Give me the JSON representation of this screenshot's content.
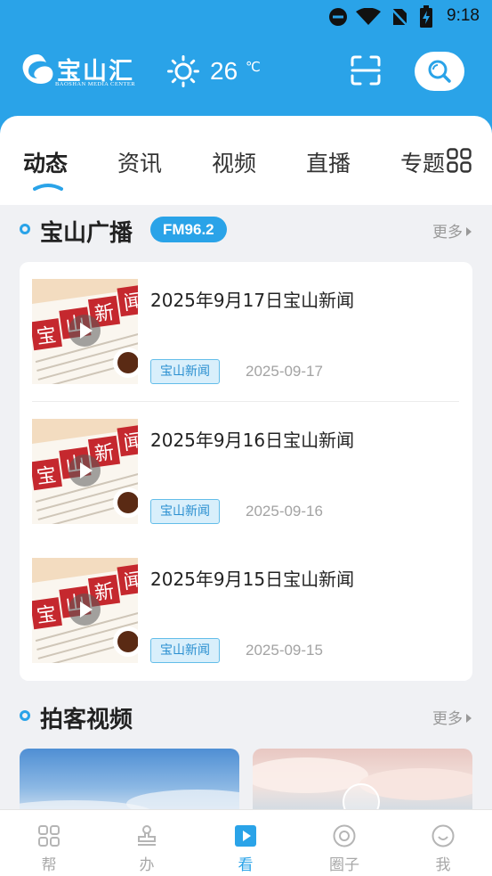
{
  "status_bar": {
    "time": "9:18"
  },
  "header": {
    "logo_text": "宝山汇",
    "logo_subtitle": "BAOSHAN MEDIA CENTER",
    "weather_icon": "sun-icon",
    "temperature": "26",
    "temperature_unit": "℃",
    "scan_icon": "scan-icon",
    "search_icon": "search-icon"
  },
  "tabs": [
    {
      "label": "动态",
      "active": true
    },
    {
      "label": "资讯",
      "active": false
    },
    {
      "label": "视频",
      "active": false
    },
    {
      "label": "直播",
      "active": false
    },
    {
      "label": "专题",
      "active": false
    }
  ],
  "radio_section": {
    "title": "宝山广播",
    "badge": "FM96.2",
    "more": "更多",
    "items": [
      {
        "title": "2025年9月17日宝山新闻",
        "tag": "宝山新闻",
        "date": "2025-09-17"
      },
      {
        "title": "2025年9月16日宝山新闻",
        "tag": "宝山新闻",
        "date": "2025-09-16"
      },
      {
        "title": "2025年9月15日宝山新闻",
        "tag": "宝山新闻",
        "date": "2025-09-15"
      }
    ]
  },
  "video_section": {
    "title": "拍客视频",
    "more": "更多"
  },
  "bottom_nav": [
    {
      "label": "帮",
      "icon": "grid-icon",
      "active": false
    },
    {
      "label": "办",
      "icon": "stamp-icon",
      "active": false
    },
    {
      "label": "看",
      "icon": "play-icon",
      "active": true
    },
    {
      "label": "圈子",
      "icon": "circle-icon",
      "active": false
    },
    {
      "label": "我",
      "icon": "smile-icon",
      "active": false
    }
  ],
  "colors": {
    "accent": "#2aa3e8",
    "tag_bg": "#d9effb",
    "tag_text": "#2a8fd0"
  }
}
